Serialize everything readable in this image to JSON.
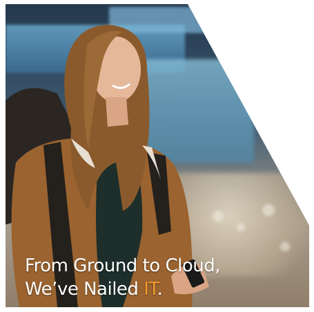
{
  "banner": {
    "photo": "woman-with-backpack-in-airport-terminal",
    "headline": {
      "line1": "From Ground to Cloud,",
      "line2_pre": "We’ve Nailed ",
      "line2_accent": "IT",
      "line2_post": "."
    }
  },
  "colors": {
    "accent": "#f39a2b",
    "headline_text": "#ffffff",
    "page_background": "#ffffff"
  }
}
